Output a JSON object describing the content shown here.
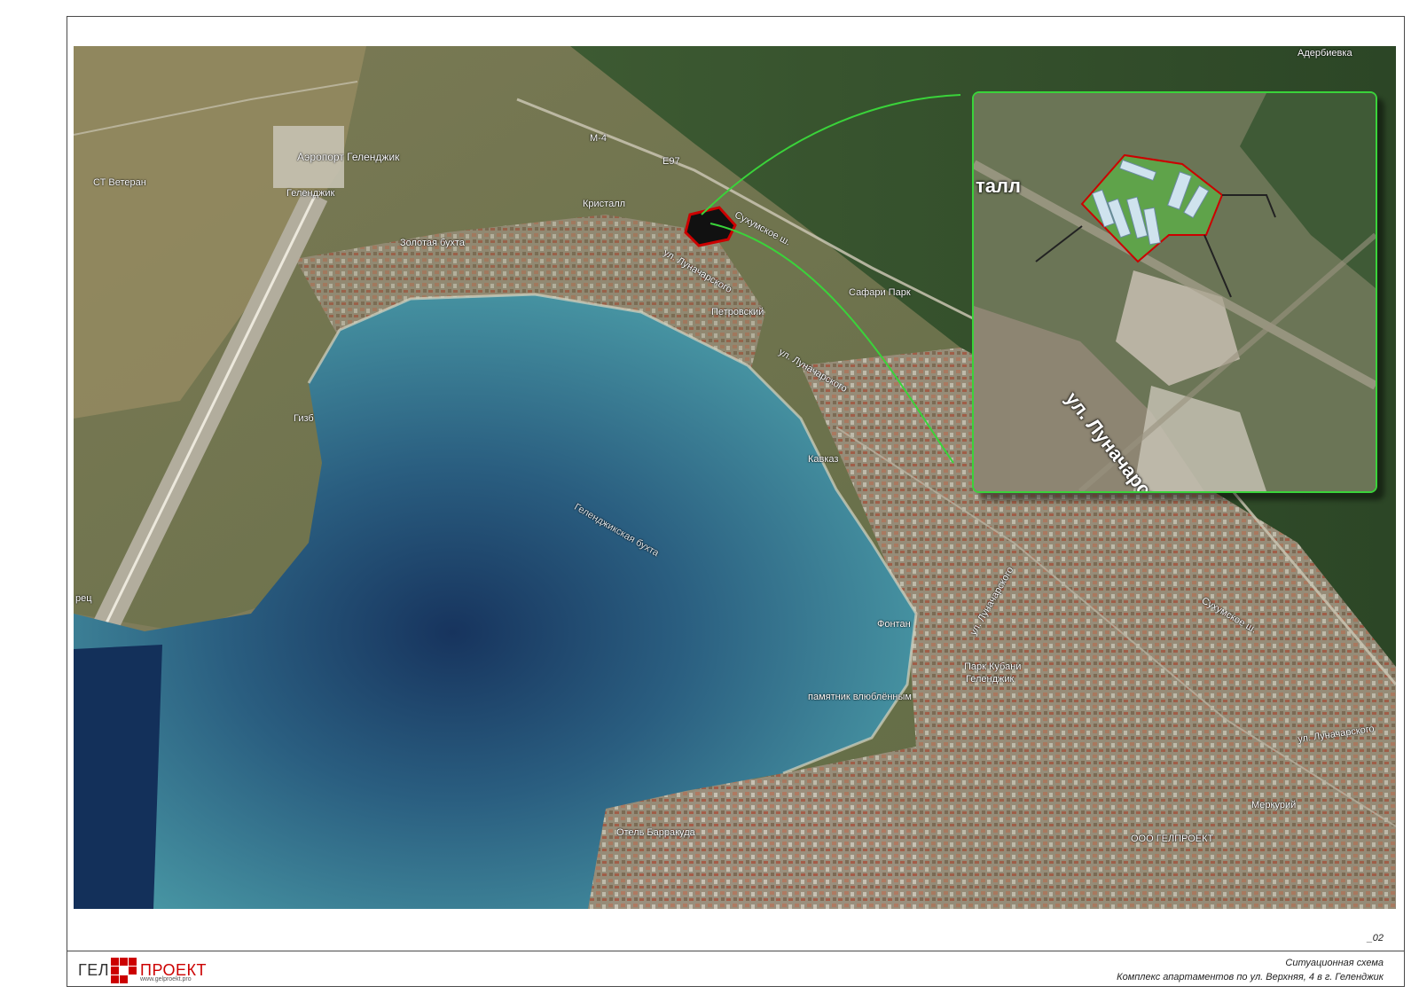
{
  "map": {
    "labels": {
      "airport": "Аэропорт Геленджик",
      "gelendzhik": "Геленджик",
      "veteran": "СТ Ветеран",
      "zolotaya_bukhta": "Золотая бухта",
      "kristall": "Кристалл",
      "petrovsky": "Петровский",
      "safari_park": "Сафари Парк",
      "sukhumskoe_shosse": "Сухумское ш.",
      "sukhumskoe_shosse_2": "Сухумское ш.",
      "lunacharskogo_1": "ул. Луначарского",
      "lunacharskogo_2": "ул. Луначарского",
      "lunacharskogo_3": "ул. Луначарского",
      "lunacharskogo_4": "ул. Луначарского",
      "gizb": "Гизб",
      "kavkaz": "Кавказ",
      "bay": "Геленджикская бухта",
      "fontan": "Фонтан",
      "park_kubani": "Парк Кубани",
      "park_kubani_2": "Геленджик",
      "monument": "памятник влюблённым",
      "otel_barrakuda": "Отель Барракуда",
      "ooo_gelproekt": "ООО ГЕЛПРОЕКТ",
      "merkuriy": "Меркурий",
      "adderbievka": "Адербиевка",
      "m4": "М-4",
      "e97": "Е97",
      "rets": "рец"
    },
    "inset": {
      "label_kristall": "талл",
      "label_street": "ул. Луначарского"
    },
    "colors": {
      "inset_border": "#3ad33a",
      "site_outline": "#cc0000",
      "sea_deep": "#17345e",
      "sea_shallow": "#3d8a9a"
    }
  },
  "sheet": {
    "page_number": "_02",
    "logo_left": "ГЕЛ",
    "logo_right": "ПРОЕКТ",
    "logo_url": "www.gelproekt.pro",
    "title": "Ситуационная схема",
    "subtitle": "Комплекс апартаментов по ул. Верхняя, 4  в г. Геленджик"
  }
}
